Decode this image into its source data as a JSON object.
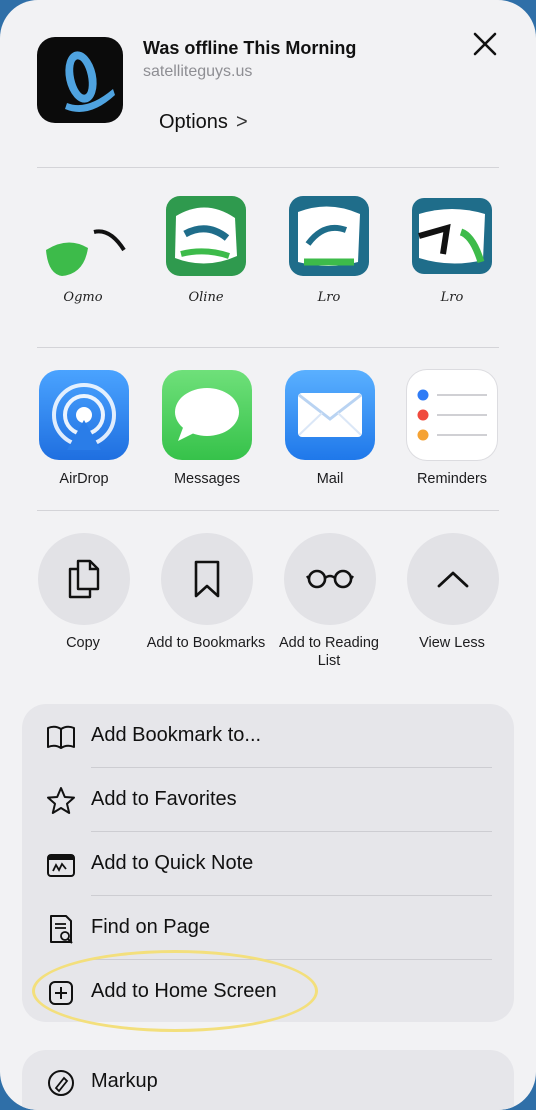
{
  "header": {
    "title": "Was offline This Morning",
    "subtitle": "satelliteguys.us",
    "options_label": "Options",
    "options_chevron": ">"
  },
  "contacts": [
    {
      "name": "Ogmo",
      "icon": "contact-avatar-icon"
    },
    {
      "name": "Oline",
      "icon": "contact-avatar-icon"
    },
    {
      "name": "Lro",
      "icon": "contact-avatar-icon"
    },
    {
      "name": "Lro",
      "icon": "contact-avatar-icon"
    }
  ],
  "apps": [
    {
      "label": "AirDrop",
      "icon": "airdrop-icon",
      "color": "#2a7de8"
    },
    {
      "label": "Messages",
      "icon": "messages-icon",
      "color": "#4cd964"
    },
    {
      "label": "Mail",
      "icon": "mail-icon",
      "color": "#2d8cf0"
    },
    {
      "label": "Reminders",
      "icon": "reminders-icon",
      "color": "#ffffff"
    }
  ],
  "actions": [
    {
      "label": "Copy",
      "icon": "copy-icon"
    },
    {
      "label": "Add to Bookmarks",
      "icon": "bookmark-icon"
    },
    {
      "label": "Add to Reading List",
      "icon": "glasses-icon"
    },
    {
      "label": "View Less",
      "icon": "chevron-up-icon"
    }
  ],
  "menu": [
    {
      "label": "Add Bookmark to...",
      "icon": "book-icon"
    },
    {
      "label": "Add to Favorites",
      "icon": "star-icon"
    },
    {
      "label": "Add to Quick Note",
      "icon": "quick-note-icon"
    },
    {
      "label": "Find on Page",
      "icon": "find-on-page-icon"
    },
    {
      "label": "Add to Home Screen",
      "icon": "plus-square-icon"
    }
  ],
  "menu2": [
    {
      "label": "Markup",
      "icon": "markup-icon"
    }
  ],
  "colors": {
    "sheet_background": "#f2f2f4",
    "highlight": "#f3df7c",
    "list_background": "#e6e6ea"
  }
}
